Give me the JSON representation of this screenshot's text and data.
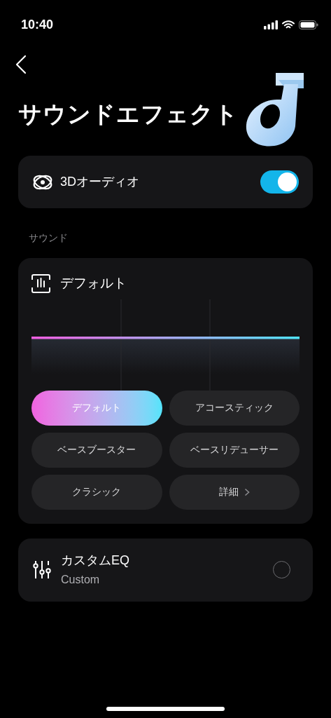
{
  "status_bar": {
    "time": "10:40"
  },
  "header": {
    "title": "サウンドエフェクト"
  },
  "audio_3d": {
    "label": "3Dオーディオ",
    "on": true
  },
  "section_label": "サウンド",
  "sound": {
    "title": "デフォルト",
    "presets": [
      {
        "kind": "preset",
        "label": "デフォルト",
        "selected": true
      },
      {
        "kind": "preset",
        "label": "アコースティック",
        "selected": false
      },
      {
        "kind": "preset",
        "label": "ベースブースター",
        "selected": false
      },
      {
        "kind": "preset",
        "label": "ベースリデューサー",
        "selected": false
      },
      {
        "kind": "preset",
        "label": "クラシック",
        "selected": false
      },
      {
        "kind": "more",
        "label": "詳細",
        "selected": false
      }
    ]
  },
  "custom_eq": {
    "title": "カスタムEQ",
    "subtitle": "Custom",
    "selected": false
  }
}
